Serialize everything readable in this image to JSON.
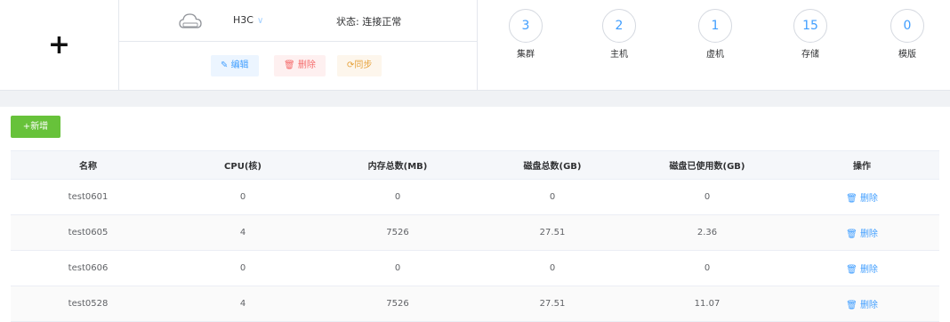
{
  "add_symbol": "+",
  "platform": {
    "icon": "cloud-icon",
    "name": "H3C",
    "status": "状态: 连接正常",
    "buttons": {
      "edit": "编辑",
      "delete": "删除",
      "sync": "同步"
    }
  },
  "stats": [
    {
      "value": "3",
      "label": "集群"
    },
    {
      "value": "2",
      "label": "主机"
    },
    {
      "value": "1",
      "label": "虚机"
    },
    {
      "value": "15",
      "label": "存储"
    },
    {
      "value": "0",
      "label": "模版"
    }
  ],
  "new_button": "新增",
  "table": {
    "headers": [
      "名称",
      "CPU(核)",
      "内存总数(MB)",
      "磁盘总数(GB)",
      "磁盘已使用数(GB)",
      "操作"
    ],
    "action_label": "删除",
    "rows": [
      {
        "name": "test0601",
        "cpu": "0",
        "mem": "0",
        "disk": "0",
        "used": "0"
      },
      {
        "name": "test0605",
        "cpu": "4",
        "mem": "7526",
        "disk": "27.51",
        "used": "2.36"
      },
      {
        "name": "test0606",
        "cpu": "0",
        "mem": "0",
        "disk": "0",
        "used": "0"
      },
      {
        "name": "test0528",
        "cpu": "4",
        "mem": "7526",
        "disk": "27.51",
        "used": "11.07"
      }
    ]
  },
  "colors": {
    "primary": "#409eff",
    "success": "#67c23a",
    "danger": "#f56c6c",
    "warning": "#e6a23c"
  }
}
